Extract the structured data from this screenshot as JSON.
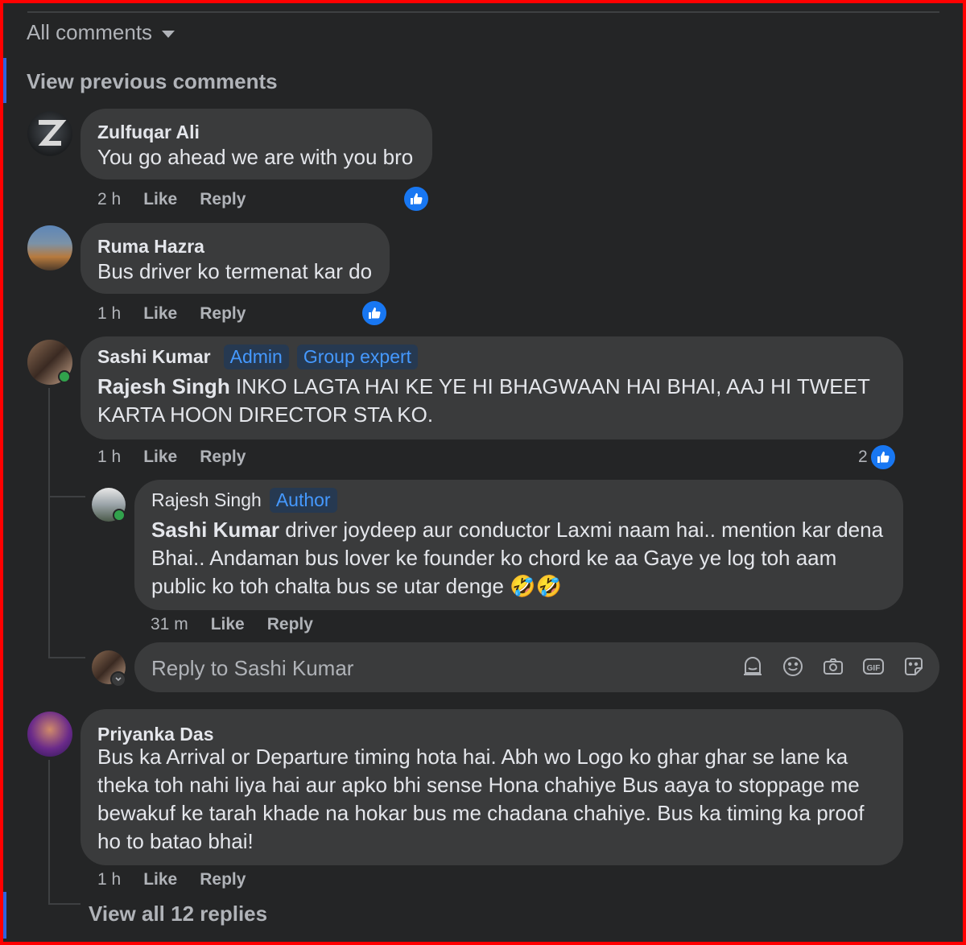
{
  "sort": {
    "label": "All comments"
  },
  "view_previous": "View previous comments",
  "comments": [
    {
      "author": "Zulfuqar Ali",
      "text": "You go ahead we are with you bro",
      "time": "2 h",
      "like": "Like",
      "reply": "Reply"
    },
    {
      "author": "Ruma Hazra",
      "text": "Bus driver ko termenat kar do",
      "time": "1 h",
      "like": "Like",
      "reply": "Reply"
    },
    {
      "author": "Sashi Kumar",
      "badge1": "Admin",
      "badge2": "Group expert",
      "mention": "Rajesh Singh",
      "text1": "INKO LAGTA HAI KE YE HI BHAGWAAN HAI BHAI, AAJ HI TWEET",
      "text2": "KARTA HOON DIRECTOR STA KO.",
      "time": "1 h",
      "like": "Like",
      "reply": "Reply",
      "reaction_count": "2"
    },
    {
      "author": "Rajesh Singh",
      "badge": "Author",
      "mention": "Sashi Kumar",
      "text1": "driver joydeep aur conductor Laxmi naam hai.. mention kar dena",
      "text2": "Bhai.. Andaman bus lover ke founder ko chord ke aa Gaye ye log toh aam",
      "text3": "public ko toh chalta bus se utar denge",
      "emoji": "🤣🤣",
      "time": "31 m",
      "like": "Like",
      "reply": "Reply"
    },
    {
      "author": "Priyanka Das",
      "text1": "Bus ka Arrival or Departure timing hota hai. Abh wo Logo ko ghar ghar se lane ka",
      "text2": "theka toh nahi liya hai aur apko bhi sense Hona chahiye Bus aaya to stoppage me",
      "text3": "bewakuf ke tarah khade na hokar bus me chadana chahiye. Bus ka timing ka proof",
      "text4": "ho to batao bhai!",
      "time": "1 h",
      "like": "Like",
      "reply": "Reply"
    }
  ],
  "reply_box": {
    "placeholder": "Reply to Sashi Kumar",
    "icons": [
      "avatar-sticker-icon",
      "emoji-icon",
      "camera-icon",
      "gif-icon",
      "sticker-icon"
    ]
  },
  "view_all": "View all 12 replies",
  "colors": {
    "background": "#242526",
    "bubble": "#3a3b3c",
    "like_blue": "#1877f2",
    "badge_text": "#4599ff",
    "frame": "#ff0000"
  }
}
